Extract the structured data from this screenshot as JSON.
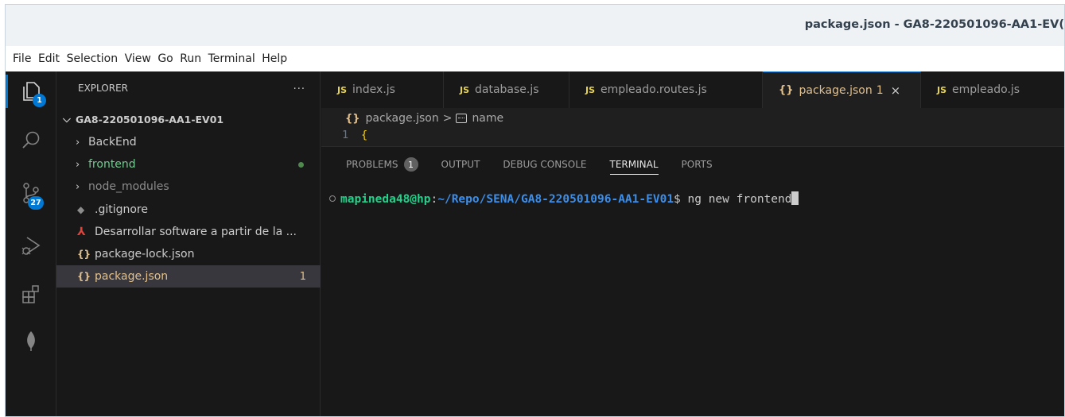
{
  "window": {
    "title": "package.json - GA8-220501096-AA1-EV("
  },
  "menubar": [
    "File",
    "Edit",
    "Selection",
    "View",
    "Go",
    "Run",
    "Terminal",
    "Help"
  ],
  "activitybar": {
    "explorer_badge": "1",
    "scm_badge": "27"
  },
  "sidebar": {
    "header": "EXPLORER",
    "more": "···",
    "root": "GA8-220501096-AA1-EV01",
    "items": [
      {
        "label": "BackEnd",
        "type": "folder",
        "color": "#cccccc"
      },
      {
        "label": "frontend",
        "type": "folder",
        "color": "#73c991"
      },
      {
        "label": "node_modules",
        "type": "folder",
        "color": "#8c8c8c"
      },
      {
        "label": ".gitignore",
        "type": "file",
        "icon": "git-diamond-icon",
        "color": "#cccccc"
      },
      {
        "label": "Desarrollar software a partir de la ...",
        "type": "file",
        "icon": "pdf-icon",
        "color": "#cccccc"
      },
      {
        "label": "package-lock.json",
        "type": "file",
        "icon": "json-icon",
        "color": "#cccccc"
      },
      {
        "label": "package.json",
        "type": "file",
        "icon": "json-icon",
        "color": "#e2c08d",
        "problems": "1"
      }
    ]
  },
  "tabs": [
    {
      "label": "index.js",
      "kind": "JS"
    },
    {
      "label": "database.js",
      "kind": "JS"
    },
    {
      "label": "empleado.routes.js",
      "kind": "JS"
    },
    {
      "label": "package.json",
      "kind": "{}",
      "count": "1",
      "close": "×"
    },
    {
      "label": "empleado.js",
      "kind": "JS"
    }
  ],
  "breadcrumb": {
    "file": "package.json",
    "separator": ">",
    "symbol": "name"
  },
  "code": {
    "line_number": "1",
    "text": "{"
  },
  "panel": {
    "tabs": [
      "PROBLEMS",
      "OUTPUT",
      "DEBUG CONSOLE",
      "TERMINAL",
      "PORTS"
    ],
    "problems_count": "1",
    "active_tab": "TERMINAL"
  },
  "terminal": {
    "user": "mapineda48@hp",
    "colon": ":",
    "path": "~/Repo/SENA/GA8-220501096-AA1-EV01",
    "prompt": "$ ",
    "command": "ng new frontend"
  },
  "colors": {
    "accent": "#0078d4",
    "user": "#23d18b",
    "path": "#3b8eea",
    "json": "#e2c08d"
  }
}
